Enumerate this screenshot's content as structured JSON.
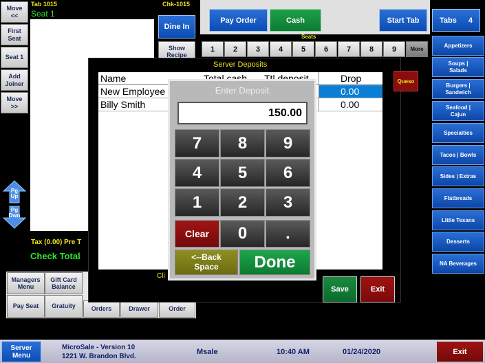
{
  "header": {
    "tab_label": "Tab  1015",
    "seat_label": "Seat 1",
    "check_label": "Chk-1015"
  },
  "left_buttons": {
    "move_prev": "Move\n<<",
    "first_seat": "First\nSeat",
    "seat1": "Seat 1",
    "add_joiner": "Add\nJoiner",
    "move_next": "Move\n>>"
  },
  "dine_in": "Dine In",
  "show_recipe": "Show\nRecipe",
  "top_buttons": {
    "pay_order": "Pay Order",
    "cash": "Cash",
    "start_tab": "Start Tab",
    "tabs": "Tabs",
    "tabs_count": "4"
  },
  "seats": {
    "title": "Seats",
    "numbers": [
      "1",
      "2",
      "3",
      "4",
      "5",
      "6",
      "7",
      "8",
      "9"
    ],
    "more": "More"
  },
  "categories": [
    "Appetizers",
    "Soups |\nSalads",
    "Burgers |\nSandwich",
    "Seafood |\nCajun",
    "Specialties",
    "Tacos | Bowls",
    "Sides | Extras",
    "Flatbreads",
    "Little Texans",
    "Desserts",
    "NA Beverages"
  ],
  "page_buttons": {
    "up": "Pg\nUp",
    "down": "Pg\nDwn"
  },
  "totals": {
    "tax": "Tax (0.00)  Pre T",
    "check_total": "Check Total"
  },
  "bottom_left": {
    "managers_menu": "Managers\nMenu",
    "gift_card_balance": "Gift Card\nBalance",
    "pay_seat": "Pay Seat",
    "gratuity": "Gratuity",
    "orders": "Orders",
    "drawer": "Drawer",
    "order": "Order"
  },
  "deposits_dialog": {
    "title": "Server Deposits",
    "columns": [
      "Name",
      "Total cash",
      "Ttl deposit",
      "Drop"
    ],
    "rows": [
      {
        "name": "New Employee",
        "drop": "0.00"
      },
      {
        "name": "Billy Smith",
        "drop": "0.00"
      }
    ],
    "footer_clip": "Cli",
    "save": "Save",
    "exit": "Exit",
    "queso": "Queso"
  },
  "keypad": {
    "title": "Enter Deposit",
    "value": "150.00",
    "keys": [
      "7",
      "8",
      "9",
      "4",
      "5",
      "6",
      "1",
      "2",
      "3"
    ],
    "clear": "Clear",
    "zero": "0",
    "dot": ".",
    "backspace": "<--Back\nSpace",
    "done": "Done"
  },
  "status_bar": {
    "server_menu": "Server\nMenu",
    "version": "MicroSale - Version 10",
    "address": "1221 W. Brandon Blvd.",
    "user": "Msale",
    "time": "10:40 AM",
    "date": "01/24/2020",
    "exit": "Exit"
  }
}
